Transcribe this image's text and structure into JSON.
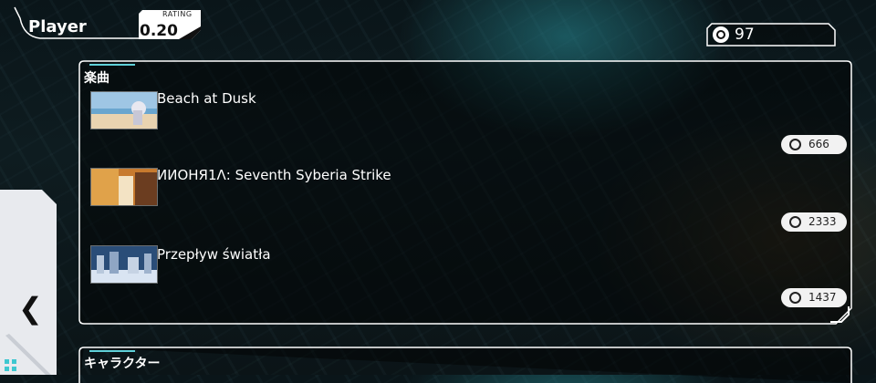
{
  "player": {
    "name": "Player",
    "rating_label": "RATING",
    "rating_value": "0.20"
  },
  "currency": {
    "icon": "coin-icon",
    "amount": "97"
  },
  "songs_section": {
    "title": "楽曲",
    "items": [
      {
        "title": "Beach at Dusk",
        "cost": "666",
        "thumb_icon": "beach-thumbnail"
      },
      {
        "title": "ИИОНЯ1Λ: Seventh Syberia Strike",
        "cost": "2333",
        "thumb_icon": "battle-thumbnail"
      },
      {
        "title": "Przepływ światła",
        "cost": "1437",
        "thumb_icon": "city-thumbnail"
      }
    ]
  },
  "characters_section": {
    "title": "キャラクター"
  },
  "nav": {
    "back_icon": "chevron-left-icon",
    "back_glyph": "❮",
    "menu_icon": "grid-icon"
  }
}
